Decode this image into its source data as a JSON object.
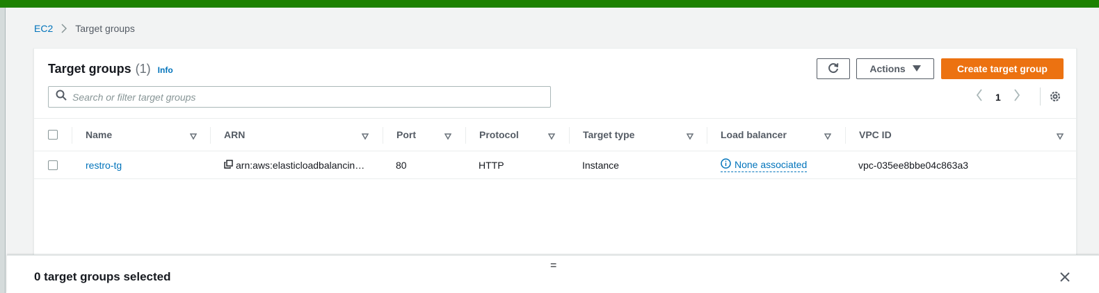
{
  "colors": {
    "top_bar": "#1d8102",
    "link": "#0073bb",
    "primary_button": "#ec7211"
  },
  "breadcrumb": {
    "root": "EC2",
    "current": "Target groups"
  },
  "panel": {
    "title": "Target groups",
    "count": "(1)",
    "info": "Info"
  },
  "toolbar": {
    "refresh_icon": "refresh-icon",
    "actions_label": "Actions",
    "create_label": "Create target group"
  },
  "search": {
    "placeholder": "Search or filter target groups",
    "value": ""
  },
  "pagination": {
    "current_page": "1"
  },
  "table": {
    "columns": [
      "Name",
      "ARN",
      "Port",
      "Protocol",
      "Target type",
      "Load balancer",
      "VPC ID"
    ],
    "rows": [
      {
        "name": "restro-tg",
        "arn": "arn:aws:elasticloadbalancin…",
        "port": "80",
        "protocol": "HTTP",
        "target_type": "Instance",
        "load_balancer": "None associated",
        "vpc_id": "vpc-035ee8bbe04c863a3"
      }
    ]
  },
  "bottom_panel": {
    "drag_handle": "=",
    "selected_text": "0 target groups selected"
  }
}
